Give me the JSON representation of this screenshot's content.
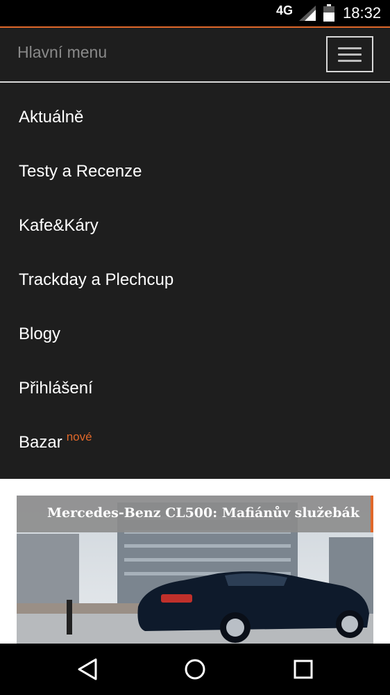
{
  "status_bar": {
    "network": "4G",
    "time": "18:32"
  },
  "header": {
    "title": "Hlavní menu",
    "menu_icon": "hamburger-icon"
  },
  "menu": {
    "items": [
      {
        "label": "Aktuálně"
      },
      {
        "label": "Testy a Recenze"
      },
      {
        "label": "Kafe&Káry"
      },
      {
        "label": "Trackday a Plechcup"
      },
      {
        "label": "Blogy"
      },
      {
        "label": "Přihlášení"
      },
      {
        "label": "Bazar",
        "badge": "nové"
      }
    ]
  },
  "article": {
    "title": "Mercedes-Benz CL500: Mafiánův služebák"
  },
  "colors": {
    "accent": "#e0682a",
    "menu_bg": "#1e1e1e",
    "title_bar": "#8c8c8c"
  },
  "nav_bar": {
    "back_icon": "back-triangle-icon",
    "home_icon": "home-circle-icon",
    "recents_icon": "recents-square-icon"
  }
}
